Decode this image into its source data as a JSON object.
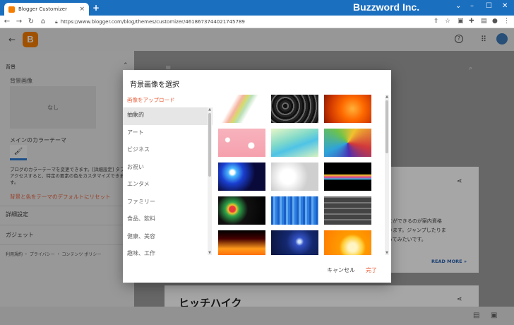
{
  "browser": {
    "tab_title": "Blogger Customizer",
    "tab_close": "×",
    "new_tab": "+",
    "url": "https://www.blogger.com/blog/themes/customizer/4618673744021745789",
    "brand": "Buzzword Inc."
  },
  "app": {
    "logo_letter": "B"
  },
  "sidebar": {
    "section_title": "背景",
    "background_image_label": "背景画像",
    "background_image_value": "なし",
    "main_theme_label": "メインのカラーテーマ",
    "theme_description": "ブログのカラーテーマを変更できます。[詳細設定] タブにアクセスすると、特定の要素の色をカスタマイズできます。",
    "reset_link": "背景と色をテーマのデフォルトにリセット",
    "items": [
      {
        "label": "詳細設定"
      },
      {
        "label": "ガジェット"
      }
    ],
    "footer": "利用規約 ・ プライバシー ・ コンテンツ ポリシー"
  },
  "preview": {
    "body_text_1": "とができるのが案内資格",
    "body_text_2": "ります。ジャンプしたりま",
    "body_text_3": "ってみたいです。",
    "read_more": "READ MORE »",
    "heading": "ヒッチハイク"
  },
  "dialog": {
    "title": "背景画像を選択",
    "upload_link": "画像をアップロード",
    "categories": [
      {
        "label": "抽象的",
        "selected": true
      },
      {
        "label": "アート",
        "selected": false
      },
      {
        "label": "ビジネス",
        "selected": false
      },
      {
        "label": "お祝い",
        "selected": false
      },
      {
        "label": "エンタメ",
        "selected": false
      },
      {
        "label": "ファミリー",
        "selected": false
      },
      {
        "label": "食品、飲料",
        "selected": false
      },
      {
        "label": "健康、美容",
        "selected": false
      },
      {
        "label": "趣味、工作",
        "selected": false
      }
    ],
    "thumbnails": [
      {
        "name": "pastel-ribbons"
      },
      {
        "name": "black-swirl-pattern"
      },
      {
        "name": "orange-fire-glow"
      },
      {
        "name": "pink-bokeh"
      },
      {
        "name": "green-blue-wave"
      },
      {
        "name": "colorful-graffiti"
      },
      {
        "name": "blue-light-burst"
      },
      {
        "name": "white-bokeh"
      },
      {
        "name": "neon-light-streaks"
      },
      {
        "name": "dark-bokeh-colors"
      },
      {
        "name": "blue-vertical-lines"
      },
      {
        "name": "gray-tiles"
      },
      {
        "name": "flames"
      },
      {
        "name": "blue-sparkles"
      },
      {
        "name": "orange-floral-swirls"
      }
    ],
    "cancel_label": "キャンセル",
    "done_label": "完了"
  },
  "colors": {
    "accent": "#e8603c",
    "titlebar": "#1b6fbf",
    "blogger_orange": "#f57d00"
  }
}
